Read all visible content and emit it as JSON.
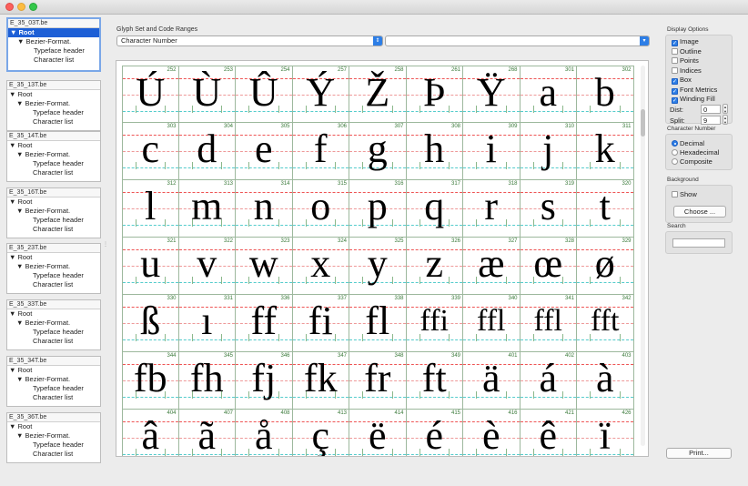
{
  "window": {
    "buttons": [
      "close",
      "minimize",
      "zoom"
    ]
  },
  "fonts": [
    {
      "file": "E_35_03T.be",
      "rows": [
        "Root",
        "Bezier-Format.",
        "Typeface header",
        "Character list"
      ],
      "selected": true
    },
    {
      "file": "E_35_13T.be",
      "rows": [
        "Root",
        "Bezier-Format.",
        "Typeface header",
        "Character list"
      ]
    },
    {
      "file": "E_35_14T.be",
      "rows": [
        "Root",
        "Bezier-Format.",
        "Typeface header",
        "Character list"
      ]
    },
    {
      "file": "E_35_16T.be",
      "rows": [
        "Root",
        "Bezier-Format.",
        "Typeface header",
        "Character list"
      ]
    },
    {
      "file": "E_35_23T.be",
      "rows": [
        "Root",
        "Bezier-Format.",
        "Typeface header",
        "Character list"
      ]
    },
    {
      "file": "E_35_33T.be",
      "rows": [
        "Root",
        "Bezier-Format.",
        "Typeface header",
        "Character list"
      ]
    },
    {
      "file": "E_35_34T.be",
      "rows": [
        "Root",
        "Bezier-Format.",
        "Typeface header",
        "Character list"
      ]
    },
    {
      "file": "E_35_36T.be",
      "rows": [
        "Root",
        "Bezier-Format.",
        "Typeface header",
        "Character list"
      ]
    }
  ],
  "glyph_set": {
    "label": "Glyph Set and Code Ranges",
    "selected": "Character Number",
    "second": ""
  },
  "glyphs": [
    [
      "Ú",
      "252"
    ],
    [
      "Ù",
      "253"
    ],
    [
      "Û",
      "254"
    ],
    [
      "Ý",
      "257"
    ],
    [
      "Ž",
      "258"
    ],
    [
      "Þ",
      "261"
    ],
    [
      "Ÿ",
      "268"
    ],
    [
      "a",
      "301"
    ],
    [
      "b",
      "302"
    ],
    [
      "c",
      "303"
    ],
    [
      "d",
      "304"
    ],
    [
      "e",
      "305"
    ],
    [
      "f",
      "306"
    ],
    [
      "g",
      "307"
    ],
    [
      "h",
      "308"
    ],
    [
      "i",
      "309"
    ],
    [
      "j",
      "310"
    ],
    [
      "k",
      "311"
    ],
    [
      "l",
      "312"
    ],
    [
      "m",
      "313"
    ],
    [
      "n",
      "314"
    ],
    [
      "o",
      "315"
    ],
    [
      "p",
      "316"
    ],
    [
      "q",
      "317"
    ],
    [
      "r",
      "318"
    ],
    [
      "s",
      "319"
    ],
    [
      "t",
      "320"
    ],
    [
      "u",
      "321"
    ],
    [
      "v",
      "322"
    ],
    [
      "w",
      "323"
    ],
    [
      "x",
      "324"
    ],
    [
      "y",
      "325"
    ],
    [
      "z",
      "326"
    ],
    [
      "æ",
      "327"
    ],
    [
      "œ",
      "328"
    ],
    [
      "ø",
      "329"
    ],
    [
      "ß",
      "330"
    ],
    [
      "ı",
      "331"
    ],
    [
      "ff",
      "336"
    ],
    [
      "fi",
      "337"
    ],
    [
      "fl",
      "338"
    ],
    [
      "ffi",
      "339"
    ],
    [
      "ffl",
      "340"
    ],
    [
      "ffl",
      "341"
    ],
    [
      "fft",
      "342"
    ],
    [
      "fb",
      "344"
    ],
    [
      "fh",
      "345"
    ],
    [
      "fj",
      "346"
    ],
    [
      "fk",
      "347"
    ],
    [
      "fr",
      "348"
    ],
    [
      "ft",
      "349"
    ],
    [
      "ä",
      "401"
    ],
    [
      "á",
      "402"
    ],
    [
      "à",
      "403"
    ],
    [
      "â",
      "404"
    ],
    [
      "ã",
      "407"
    ],
    [
      "å",
      "408"
    ],
    [
      "ç",
      "413"
    ],
    [
      "ë",
      "414"
    ],
    [
      "é",
      "415"
    ],
    [
      "è",
      "416"
    ],
    [
      "ê",
      "421"
    ],
    [
      "ï",
      "426"
    ]
  ],
  "display_options": {
    "title": "Display Options",
    "items": [
      {
        "label": "Image",
        "checked": true
      },
      {
        "label": "Outline",
        "checked": false
      },
      {
        "label": "Points",
        "checked": false
      },
      {
        "label": "Indices",
        "checked": false
      },
      {
        "label": "Box",
        "checked": true
      },
      {
        "label": "Font Metrics",
        "checked": true
      },
      {
        "label": "Winding Fill",
        "checked": true
      }
    ],
    "dist_label": "Dist:",
    "dist_value": "0",
    "split_label": "Split:",
    "split_value": "9"
  },
  "character_number": {
    "title": "Character Number",
    "options": [
      {
        "label": "Decimal",
        "selected": true
      },
      {
        "label": "Hexadecimal",
        "selected": false
      },
      {
        "label": "Composite",
        "selected": false
      }
    ]
  },
  "background": {
    "title": "Background",
    "show_label": "Show",
    "show_checked": false,
    "choose_label": "Choose ..."
  },
  "search": {
    "title": "Search",
    "value": ""
  },
  "print_label": "Print...",
  "colors": {
    "selection": "#1d5fd6",
    "accent": "#2d7ee6",
    "ascender_line": "#e55555",
    "baseline": "#55cccc",
    "grid": "#9db89d"
  }
}
